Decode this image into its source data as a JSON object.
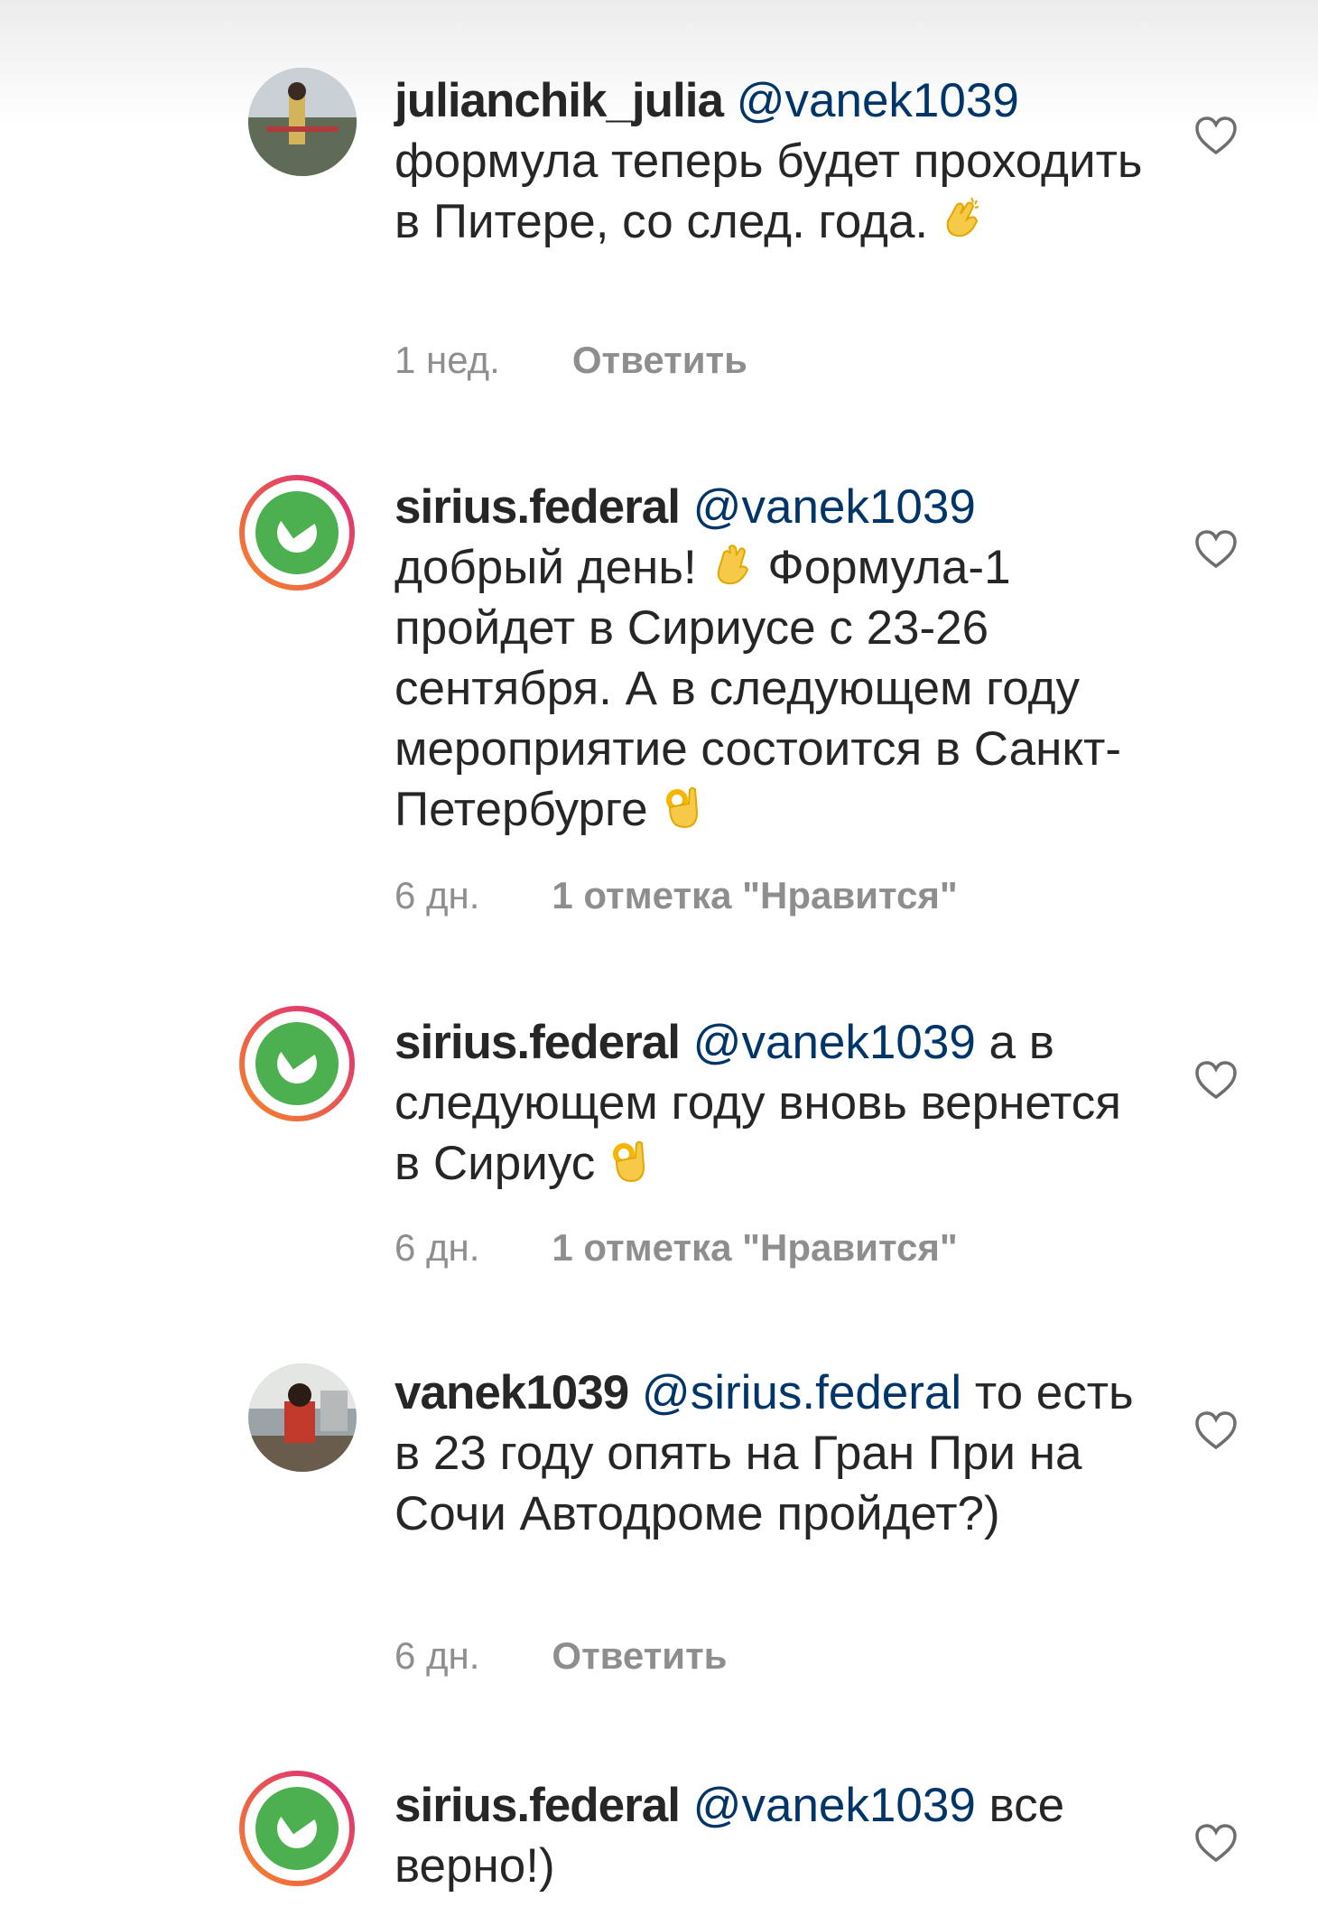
{
  "comments": [
    {
      "username": "julianchik_julia",
      "mention": "@vanek1039",
      "text": "формула теперь будет проходить в Питере, со след. года.",
      "emoji": "clapping-hands",
      "time": "1 нед.",
      "action": "Ответить",
      "avatar": "user-photo"
    },
    {
      "username": "sirius.federal",
      "mention": "@vanek1039",
      "text": "добрый день!",
      "emoji": "waving-hand",
      "text2": "Формула-1 пройдет в Сириусе с 23-26 сентября. А в следующем году мероприятие состоится в Санкт-Петербурге",
      "emoji2": "ok-hand",
      "time": "6 дн.",
      "action": "1 отметка \"Нравится\"",
      "avatar": "sirius-logo"
    },
    {
      "username": "sirius.federal",
      "mention": "@vanek1039",
      "text": "а в следующем году вновь вернется в Сириус",
      "emoji": "ok-hand",
      "time": "6 дн.",
      "action": "1 отметка \"Нравится\"",
      "avatar": "sirius-logo"
    },
    {
      "username": "vanek1039",
      "mention": "@sirius.federal",
      "text": "то есть в 23 году опять на Гран При на Сочи Автодроме пройдет?)",
      "time": "6 дн.",
      "action": "Ответить",
      "avatar": "user-photo"
    },
    {
      "username": "sirius.federal",
      "mention": "@vanek1039",
      "text": "все верно!)",
      "avatar": "sirius-logo"
    }
  ],
  "colors": {
    "mention": "#003569",
    "meta": "#8e8e8e",
    "sirius_green": "#4caf50",
    "story_ring_start": "#f58529",
    "story_ring_end": "#dd2a7b"
  },
  "icons": {
    "like": "heart-outline-icon"
  }
}
